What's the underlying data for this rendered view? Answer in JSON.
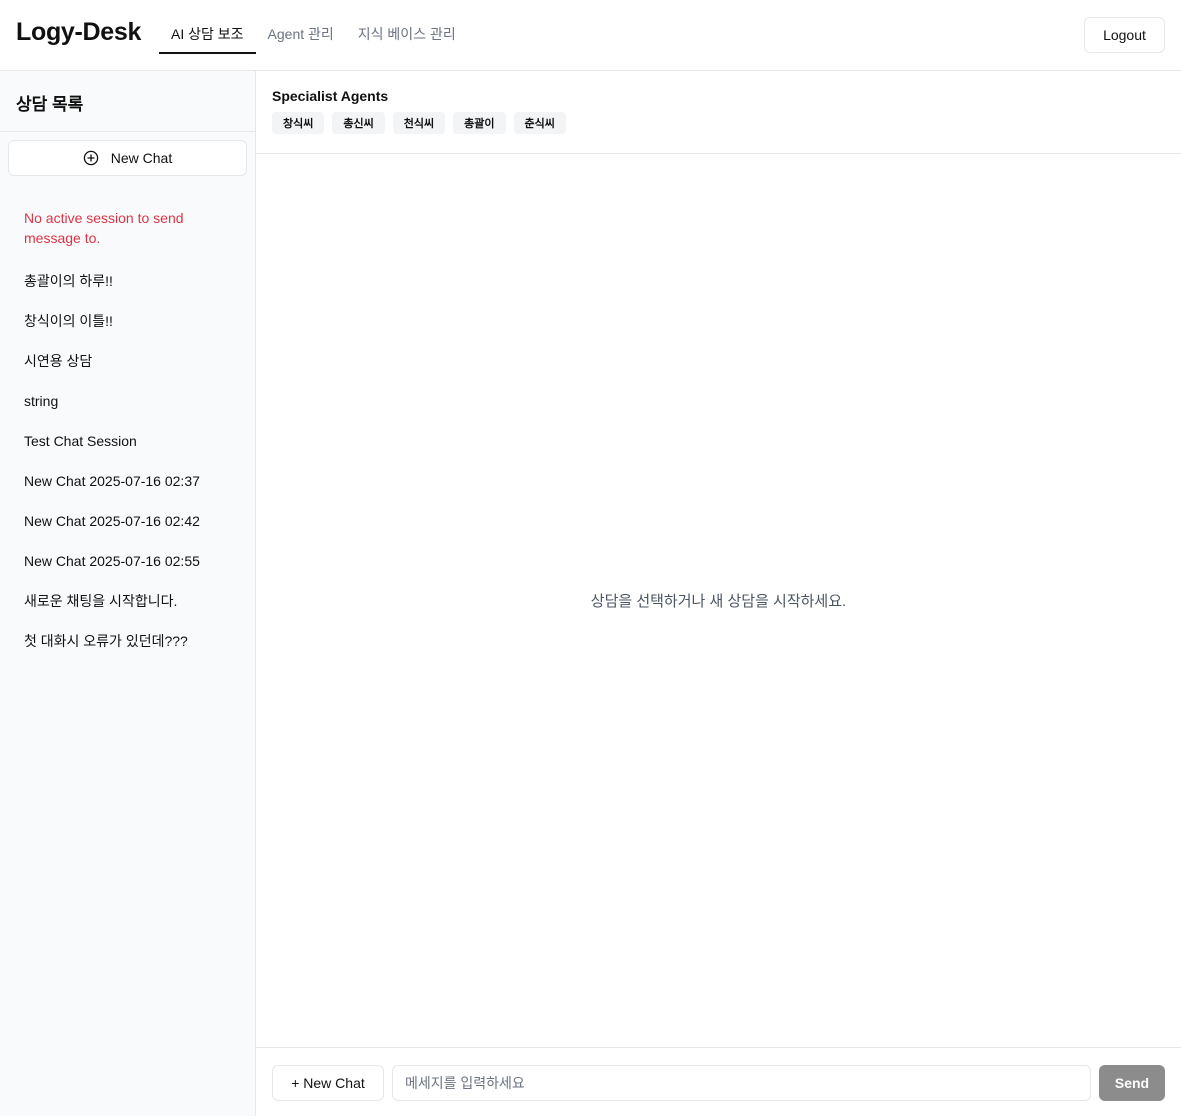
{
  "header": {
    "brand": "Logy-Desk",
    "tabs": [
      {
        "label": "AI 상담 보조",
        "active": true
      },
      {
        "label": "Agent 관리",
        "active": false
      },
      {
        "label": "지식 베이스 관리",
        "active": false
      }
    ],
    "logout_label": "Logout"
  },
  "sidebar": {
    "title": "상담 목록",
    "new_chat_label": "New Chat",
    "new_chat_icon": "plus-circle-icon",
    "error_message": "No active session to send message to.",
    "sessions": [
      "총괄이의 하루!!",
      "창식이의 이틀!!",
      "시연용 상담",
      "string",
      "Test Chat Session",
      "New Chat 2025-07-16 02:37",
      "New Chat 2025-07-16 02:42",
      "New Chat 2025-07-16 02:55",
      "새로운 채팅을 시작합니다.",
      "첫 대화시 오류가 있던데???"
    ]
  },
  "main": {
    "agents_title": "Specialist Agents",
    "agents": [
      "창식씨",
      "총신씨",
      "천식씨",
      "총괄이",
      "춘식씨"
    ],
    "empty_state": "상담을 선택하거나 새 상담을 시작하세요."
  },
  "composer": {
    "new_chat_label": "+ New Chat",
    "input_placeholder": "메세지를 입력하세요",
    "input_value": "",
    "send_label": "Send"
  },
  "colors": {
    "error": "#dc3545",
    "send_disabled": "#8c8c8c",
    "sidebar_bg": "#f9fafb",
    "chip_bg": "#f3f4f6"
  }
}
